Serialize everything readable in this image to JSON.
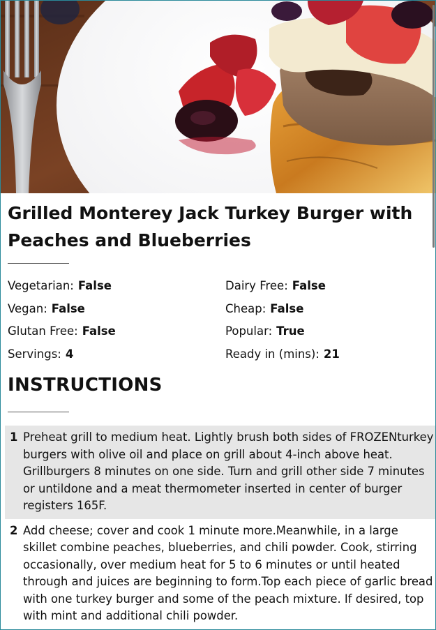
{
  "recipe": {
    "title": "Grilled Monterey Jack Turkey Burger with Peaches and Blueberries",
    "properties": [
      {
        "label": "Vegetarian:",
        "value": "False"
      },
      {
        "label": "Dairy Free:",
        "value": "False"
      },
      {
        "label": "Vegan:",
        "value": "False"
      },
      {
        "label": "Cheap:",
        "value": "False"
      },
      {
        "label": "Glutan Free:",
        "value": "False"
      },
      {
        "label": "Popular:",
        "value": "True"
      },
      {
        "label": "Servings:",
        "value": "4"
      },
      {
        "label": "Ready in (mins):",
        "value": "21"
      }
    ],
    "instructions_heading": "INSTRUCTIONS",
    "steps": [
      {
        "number": "1",
        "text": "Preheat grill to medium heat. Lightly brush both sides of FROZENturkey burgers with olive oil and place on grill about 4-inch above heat. Grillburgers 8 minutes on one side. Turn and grill other side 7 minutes or untildone and a meat thermometer inserted in center of burger registers 165F."
      },
      {
        "number": "2",
        "text": "Add cheese; cover and cook 1 minute more.Meanwhile, in a large skillet combine peaches, blueberries, and chili powder. Cook, stirring occasionally, over medium heat for 5 to 6 minutes or until heated through and juices are beginning to form.Top each piece of garlic bread with one turkey burger and some of the peach mixture. If desired, top with mint and additional chili powder."
      }
    ]
  },
  "colors": {
    "accent_border": "#2a8a9a",
    "alt_row": "#e6e6e6"
  }
}
